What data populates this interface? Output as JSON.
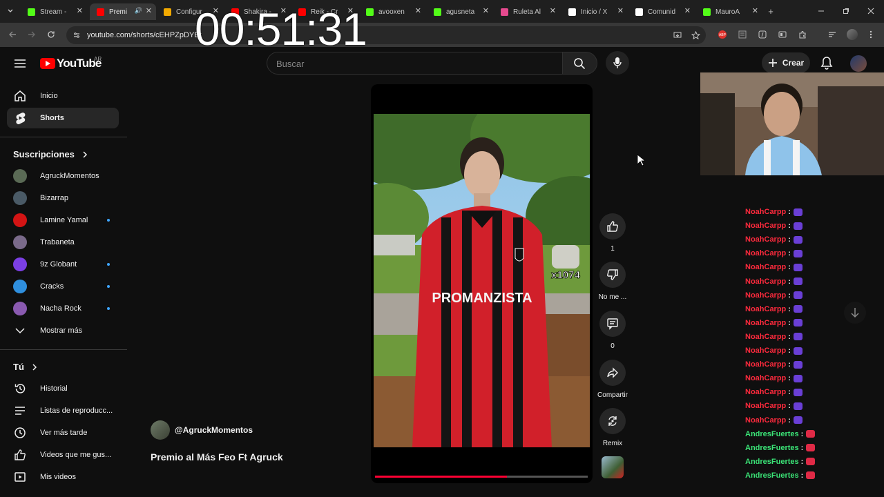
{
  "browser": {
    "tabs": [
      {
        "label": "Stream -",
        "favicon": "kick-icon",
        "color": "#53fc18"
      },
      {
        "label": "Premi",
        "favicon": "youtube-icon",
        "color": "#ff0000",
        "active": true
      },
      {
        "label": "Configur",
        "favicon": "settings-app-icon",
        "color": "#f2a900"
      },
      {
        "label": "Shakira -",
        "favicon": "youtube-icon",
        "color": "#ff0000"
      },
      {
        "label": "Reik - Cr",
        "favicon": "youtube-icon",
        "color": "#ff0000"
      },
      {
        "label": "avooxen",
        "favicon": "kick-icon",
        "color": "#53fc18"
      },
      {
        "label": "agusneta",
        "favicon": "kick-icon",
        "color": "#53fc18"
      },
      {
        "label": "Ruleta Al",
        "favicon": "wheel-icon",
        "color": "#e64a8f"
      },
      {
        "label": "Inicio / X",
        "favicon": "x-icon",
        "color": "#ffffff"
      },
      {
        "label": "Comunid",
        "favicon": "x-icon",
        "color": "#ffffff"
      },
      {
        "label": "MauroA",
        "favicon": "kick-icon",
        "color": "#53fc18"
      }
    ],
    "new_tab": "+",
    "url": "youtube.com/shorts/cEHPZpDYBt"
  },
  "overlay": {
    "clock": "00:51:31"
  },
  "youtube": {
    "logo_text": "YouTube",
    "region": "AR",
    "search_placeholder": "Buscar",
    "create_label": "Crear"
  },
  "sidebar": {
    "main": [
      {
        "label": "Inicio",
        "icon": "home-icon"
      },
      {
        "label": "Shorts",
        "icon": "shorts-icon",
        "selected": true
      }
    ],
    "subscriptions_title": "Suscripciones",
    "subscriptions": [
      {
        "label": "AgruckMomentos",
        "color": "#5a6a55",
        "new": false
      },
      {
        "label": "Bizarrap",
        "color": "#4a5a66",
        "new": false
      },
      {
        "label": "Lamine Yamal",
        "color": "#d31414",
        "new": true
      },
      {
        "label": "Trabaneta",
        "color": "#7a6a8a",
        "new": false
      },
      {
        "label": "9z Globant",
        "color": "#7b3fe4",
        "new": true
      },
      {
        "label": "Cracks",
        "color": "#2f8fde",
        "new": true
      },
      {
        "label": "Nacha Rock",
        "color": "#8a5ab0",
        "new": true
      }
    ],
    "show_more": "Mostrar más",
    "you_title": "Tú",
    "you": [
      {
        "label": "Historial",
        "icon": "history-icon"
      },
      {
        "label": "Listas de reproducc...",
        "icon": "playlist-icon"
      },
      {
        "label": "Ver más tarde",
        "icon": "clock-icon"
      },
      {
        "label": "Videos que me gus...",
        "icon": "like-icon"
      },
      {
        "label": "Mis videos",
        "icon": "my-videos-icon"
      }
    ]
  },
  "short": {
    "channel": "@AgruckMomentos",
    "title": "Premio al Más Feo Ft Agruck",
    "jersey_text": "PROMANZISTA",
    "sticker_text": "x1074",
    "progress": 0.62,
    "actions": {
      "likes": "1",
      "dislike": "No me ...",
      "comments": "0",
      "share": "Compartir",
      "remix": "Remix"
    }
  },
  "chat": [
    {
      "user": "NoahCarpp",
      "sep": ":",
      "color": "#ff2a3d",
      "emote": "#6a3fd6"
    },
    {
      "user": "NoahCarpp",
      "sep": ":",
      "color": "#ff2a3d",
      "emote": "#6a3fd6"
    },
    {
      "user": "NoahCarpp",
      "sep": ":",
      "color": "#ff2a3d",
      "emote": "#6a3fd6"
    },
    {
      "user": "NoahCarpp",
      "sep": ":",
      "color": "#ff2a3d",
      "emote": "#6a3fd6"
    },
    {
      "user": "NoahCarpp",
      "sep": ":",
      "color": "#ff2a3d",
      "emote": "#6a3fd6"
    },
    {
      "user": "NoahCarpp",
      "sep": ":",
      "color": "#ff2a3d",
      "emote": "#6a3fd6"
    },
    {
      "user": "NoahCarpp",
      "sep": ":",
      "color": "#ff2a3d",
      "emote": "#6a3fd6"
    },
    {
      "user": "NoahCarpp",
      "sep": ":",
      "color": "#ff2a3d",
      "emote": "#6a3fd6"
    },
    {
      "user": "NoahCarpp",
      "sep": ":",
      "color": "#ff2a3d",
      "emote": "#6a3fd6"
    },
    {
      "user": "NoahCarpp",
      "sep": ":",
      "color": "#ff2a3d",
      "emote": "#6a3fd6"
    },
    {
      "user": "NoahCarpp",
      "sep": ":",
      "color": "#ff2a3d",
      "emote": "#6a3fd6"
    },
    {
      "user": "NoahCarpp",
      "sep": ":",
      "color": "#ff2a3d",
      "emote": "#6a3fd6"
    },
    {
      "user": "NoahCarpp",
      "sep": ":",
      "color": "#ff2a3d",
      "emote": "#6a3fd6"
    },
    {
      "user": "NoahCarpp",
      "sep": ":",
      "color": "#ff2a3d",
      "emote": "#6a3fd6"
    },
    {
      "user": "NoahCarpp",
      "sep": ":",
      "color": "#ff2a3d",
      "emote": "#6a3fd6"
    },
    {
      "user": "NoahCarpp",
      "sep": ":",
      "color": "#ff2a3d",
      "emote": "#6a3fd6"
    },
    {
      "user": "AndresFuertes",
      "sep": ":",
      "color": "#3be477",
      "emote": "#e02a46"
    },
    {
      "user": "AndresFuertes",
      "sep": ":",
      "color": "#3be477",
      "emote": "#e02a46"
    },
    {
      "user": "AndresFuertes",
      "sep": ":",
      "color": "#3be477",
      "emote": "#e02a46"
    },
    {
      "user": "AndresFuertes",
      "sep": ":",
      "color": "#3be477",
      "emote": "#e02a46"
    }
  ]
}
